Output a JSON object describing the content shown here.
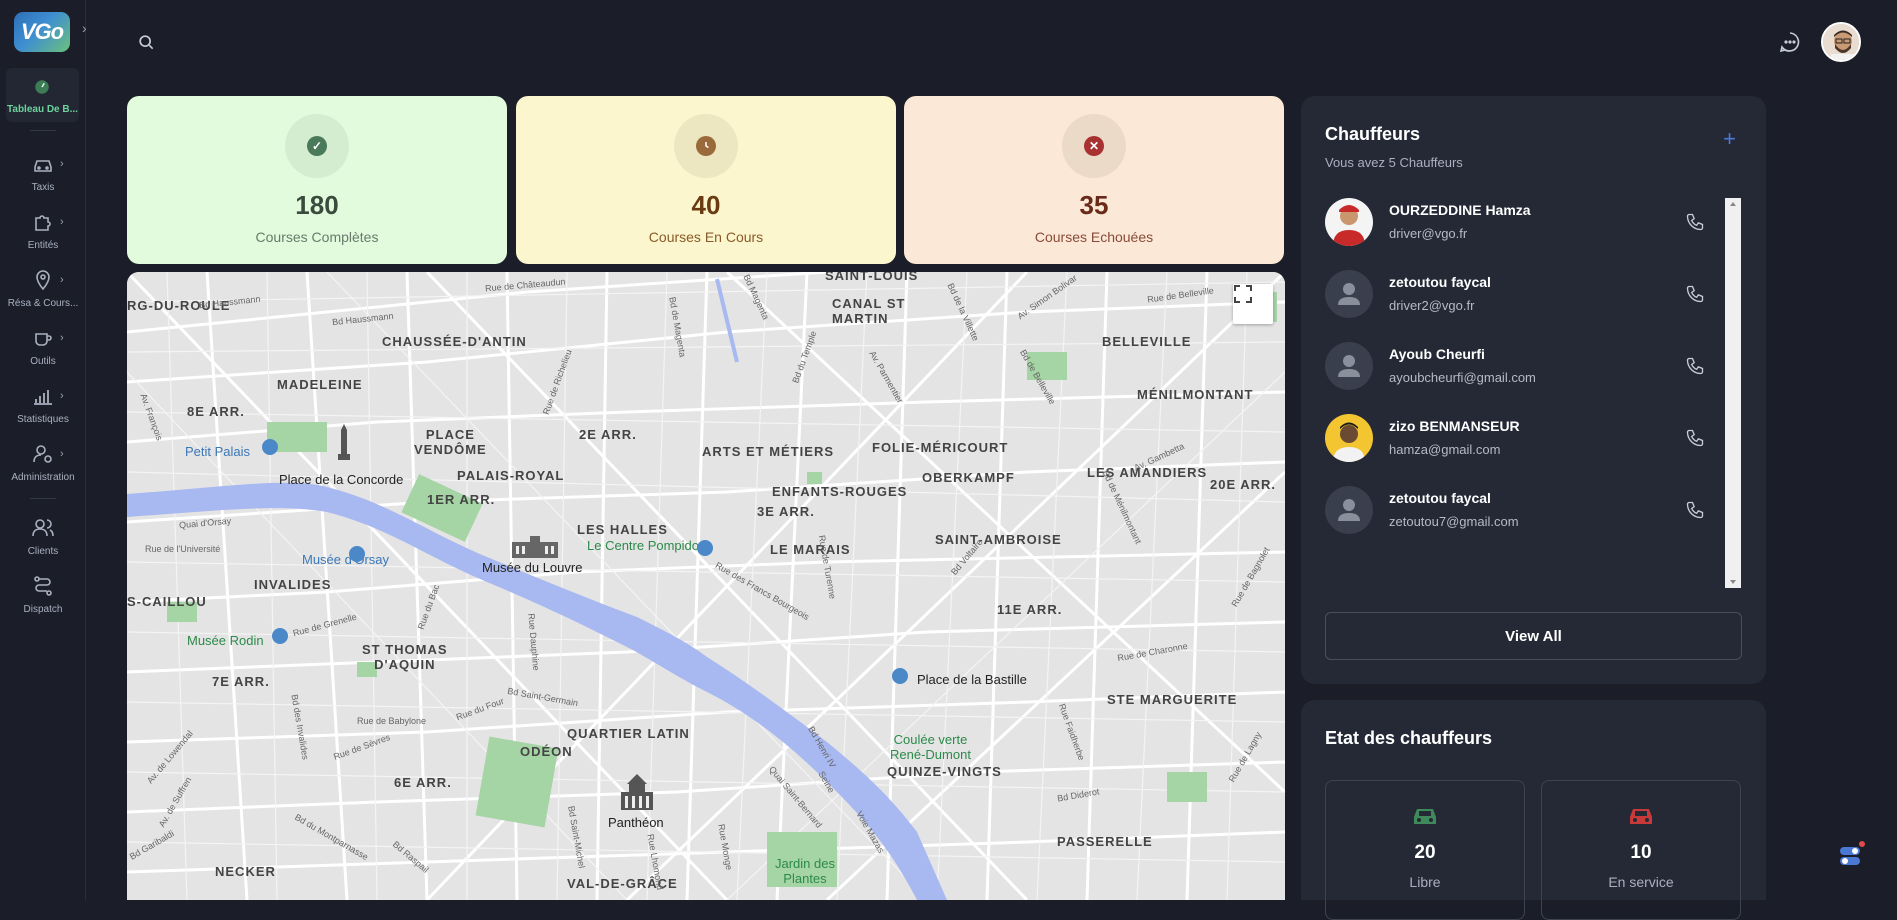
{
  "app": {
    "logo_text": "VGo"
  },
  "sidebar": {
    "active_label": "Tableau De B...",
    "items": [
      {
        "label": "Taxis",
        "icon": "car-icon"
      },
      {
        "label": "Entités",
        "icon": "puzzle-icon"
      },
      {
        "label": "Résa & Cours...",
        "icon": "map-pin-icon"
      },
      {
        "label": "Outils",
        "icon": "cup-icon"
      },
      {
        "label": "Statistiques",
        "icon": "bar-chart-icon"
      },
      {
        "label": "Administration",
        "icon": "user-cog-icon"
      },
      {
        "label": "Clients",
        "icon": "users-icon"
      },
      {
        "label": "Dispatch",
        "icon": "route-icon"
      }
    ]
  },
  "stats": [
    {
      "value": "180",
      "label": "Courses Complètes",
      "bg": "#e2fbdd",
      "color": "#3a4a3c",
      "accent": "#4a7a5a"
    },
    {
      "value": "40",
      "label": "Courses En Cours",
      "bg": "#fbf6cd",
      "color": "#6a3a12",
      "accent": "#9a6a3a"
    },
    {
      "value": "35",
      "label": "Courses Echouées",
      "bg": "#fbe8d6",
      "color": "#6a2a1a",
      "accent": "#a83232"
    }
  ],
  "map": {
    "labels": {
      "saint_louis": "SAINT-LOUIS",
      "canal_st_martin": "CANAL ST\nMARTIN",
      "chaussee": "CHAUSSÉE-D'ANTIN",
      "belleville": "BELLEVILLE",
      "madeleine": "MADELEINE",
      "menilmontant": "MÉNILMONTANT",
      "arr8": "8E ARR.",
      "place_vendome": "PLACE\nVENDÔME",
      "arr2": "2E ARR.",
      "arts_metiers": "ARTS ET MÉTIERS",
      "folie": "FOLIE-MÉRICOURT",
      "petit_palais": "Petit Palais",
      "palais_royal": "PALAIS-ROYAL",
      "amandiers": "LES AMANDIERS",
      "concorde": "Place de la Concorde",
      "enfants_rouges": "ENFANTS-ROUGES",
      "oberkampf": "OBERKAMPF",
      "arr20": "20E ARR.",
      "arr1": "1ER ARR.",
      "arr3": "3E ARR.",
      "halles": "LES HALLES",
      "pompidou": "Le Centre Pompidou",
      "saint_ambroise": "SAINT-AMBROISE",
      "orsay": "Musée d'Orsay",
      "louvre": "Musée du Louvre",
      "marais": "LE MARAIS",
      "invalides": "INVALIDES",
      "caillou": "S-CAILLOU",
      "arr11": "11E ARR.",
      "rodin": "Musée Rodin",
      "st_thomas": "ST THOMAS\nD'AQUIN",
      "bastille": "Place de la Bastille",
      "arr7": "7E ARR.",
      "ste_marguerite": "STE MARGUERITE",
      "quartier_latin": "QUARTIER LATIN",
      "coulee": "Coulée verte\nRené-Dumont",
      "odeon": "ODÉON",
      "quinze_vingts": "QUINZE-VINGTS",
      "arr6": "6E ARR.",
      "pantheon": "Panthéon",
      "passerelle": "PASSERELLE",
      "necker": "NECKER",
      "val_de_grace": "VAL-DE-GRÂCE",
      "jardin": "Jardin des\nPlantes",
      "rg_du_roule": "RG-DU-ROULE",
      "seine": "Seine"
    },
    "streets": {
      "haussmann1": "Bd Haussmann",
      "haussmann2": "Bd Haussmann",
      "chateaudun": "Rue de Châteaudun",
      "belleville_rue": "Rue de Belleville",
      "simon_bolivar": "Av. Simon Bolivar",
      "magenta": "Bd Magenta",
      "villette": "Bd de la Villette",
      "richelieu": "Rue de Richelieu",
      "orsay_quai": "Quai d'Orsay",
      "universite": "Rue de l'Université",
      "grenelle": "Rue de Grenelle",
      "bac": "Rue du Bac",
      "four": "Rue du Four",
      "babylone": "Rue de Babylone",
      "sevres": "Rue de Sèvres",
      "st_germain": "Bd Saint-Germain",
      "montparnasse": "Bd du Montparnasse",
      "raspail": "Bd Raspail",
      "voltaire": "Bd Voltaire",
      "charonne": "Rue de Charonne",
      "diderot": "Bd Diderot",
      "turenne": "Rue de Turenne",
      "francs_bourgeois": "Rue des Francs Bourgeois",
      "menilmontant_bd": "Bd de Ménilmontant",
      "gambetta": "Av. Gambetta",
      "faidherbe": "Rue Faidherbe",
      "henri_iv": "Bd Henri IV",
      "mazas": "Voie Mazas",
      "monge": "Rue Monge",
      "suffren": "Av. de Suffren",
      "invalides_bd": "Bd des Invalides",
      "lowendal": "Av. de Lowendal",
      "garibaldi": "Bd Garibaldi",
      "st_michel": "Bd Saint-Michel",
      "st_bernard": "Quai Saint-Bernard",
      "francois": "Av. François",
      "temple": "Bd du Temple",
      "magenta2": "Bd de Magenta",
      "bagnolet": "Rue de Bagnolet",
      "parmentier": "Av. Parmentier",
      "belleville_bd": "Bd de Belleville",
      "lhomond": "Rue Lhomond",
      "dauphine": "Rue Dauphine",
      "lagny": "Rue de Lagny"
    }
  },
  "chauffeurs": {
    "title": "Chauffeurs",
    "subtitle": "Vous avez 5 Chauffeurs",
    "list": [
      {
        "name": "OURZEDDINE Hamza",
        "email": "driver@vgo.fr",
        "avatar": "photo-red"
      },
      {
        "name": "zetoutou faycal",
        "email": "driver2@vgo.fr",
        "avatar": "default"
      },
      {
        "name": "Ayoub Cheurfi",
        "email": "ayoubcheurfi@gmail.com",
        "avatar": "default"
      },
      {
        "name": "zizo BENMANSEUR",
        "email": "hamza@gmail.com",
        "avatar": "photo-yellow"
      },
      {
        "name": "zetoutou faycal",
        "email": "zetoutou7@gmail.com",
        "avatar": "default"
      }
    ],
    "view_all": "View All"
  },
  "etat": {
    "title": "Etat des chauffeurs",
    "boxes": [
      {
        "value": "20",
        "label": "Libre",
        "color": "#3f8a5a"
      },
      {
        "value": "10",
        "label": "En service",
        "color": "#c83a3a"
      }
    ]
  }
}
